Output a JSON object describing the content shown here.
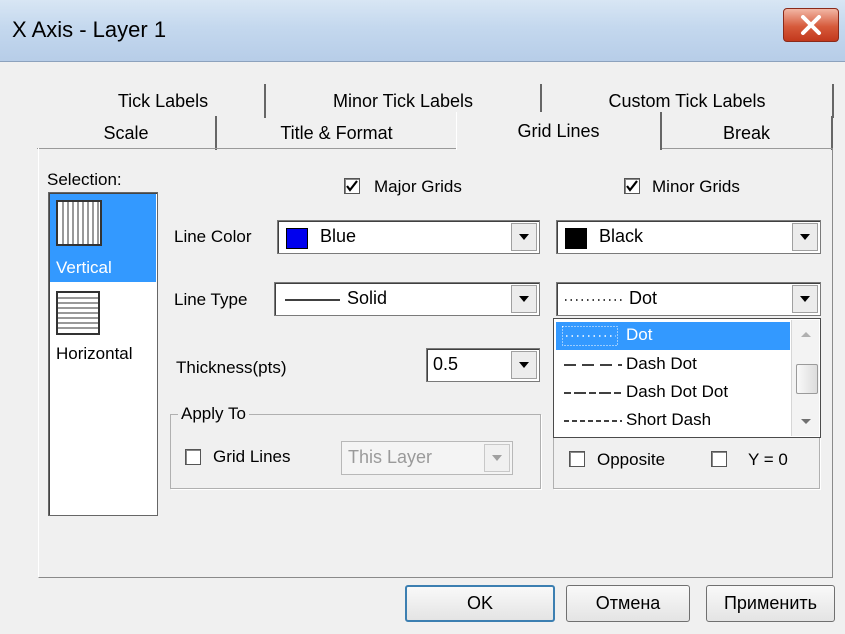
{
  "window": {
    "title": "X Axis - Layer 1"
  },
  "tabs": {
    "row_back": [
      "Tick Labels",
      "Minor Tick Labels",
      "Custom Tick Labels"
    ],
    "row_front": [
      "Scale",
      "Title & Format",
      "Grid Lines",
      "Break"
    ],
    "active": "Grid Lines"
  },
  "selection": {
    "label": "Selection:",
    "items": [
      {
        "label": "Vertical",
        "selected": true,
        "icon": "vertical-grid-icon"
      },
      {
        "label": "Horizontal",
        "selected": false,
        "icon": "horizontal-grid-icon"
      }
    ]
  },
  "major": {
    "checkbox_label": "Major Grids",
    "checked": true,
    "line_color": {
      "value": "Blue",
      "swatch": "#0000ee"
    },
    "line_type": {
      "value": "Solid"
    },
    "thickness": {
      "value": "0.5"
    }
  },
  "minor": {
    "checkbox_label": "Minor Grids",
    "checked": true,
    "line_color": {
      "value": "Black",
      "swatch": "#000000"
    },
    "line_type": {
      "value": "Dot"
    }
  },
  "labels": {
    "line_color": "Line Color",
    "line_type": "Line Type",
    "thickness": "Thickness(pts)"
  },
  "apply_to": {
    "legend": "Apply To",
    "grid_lines_label": "Grid Lines",
    "grid_lines_checked": false,
    "scope_value": "This Layer"
  },
  "additional": {
    "opposite_label": "Opposite",
    "opposite_checked": false,
    "y0_label": "Y = 0",
    "y0_checked": false
  },
  "line_type_dropdown": {
    "open": true,
    "options": [
      "Dot",
      "Dash Dot",
      "Dash Dot Dot",
      "Short Dash"
    ],
    "highlighted": "Dot"
  },
  "buttons": {
    "ok": "OK",
    "cancel": "Отмена",
    "apply": "Применить"
  },
  "colors": {
    "selection_highlight": "#3399ff",
    "dialog_bg": "#f0f0f0"
  }
}
